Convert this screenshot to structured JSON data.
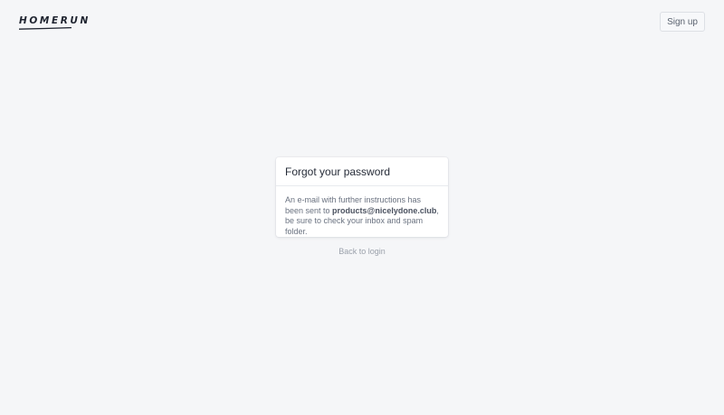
{
  "header": {
    "logo_text": "HOMERUN",
    "signup_label": "Sign up"
  },
  "card": {
    "title": "Forgot your password",
    "message_before": "An e-mail with further instructions has been sent to ",
    "email": "products@nicelydone.club",
    "message_after": ", be sure to check your inbox and spam folder."
  },
  "footer": {
    "back_label": "Back to login"
  },
  "colors": {
    "background": "#f5f6f8",
    "card": "#ffffff",
    "text_dark": "#262c38",
    "text_muted": "#6a7280",
    "link_muted": "#9ba1ab"
  }
}
